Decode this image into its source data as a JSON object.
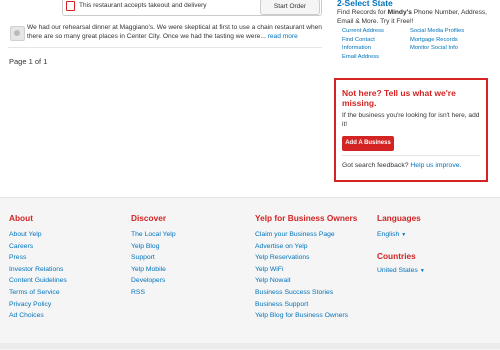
{
  "takeout": {
    "text": "This restaurant accepts takeout and delivery",
    "start_order": "Start Order"
  },
  "review": {
    "text": "We had our rehearsal dinner at Maggiano's. We were skeptical at first to use a chain restaurant when there are so many great places in Center City. Once we had the tasting we were...",
    "read_more": "read more"
  },
  "pagination": "Page 1 of 1",
  "select_state": {
    "title": "2-Select State",
    "desc_prefix": "Find Records for ",
    "desc_name": "Mindy's",
    "desc_suffix": " Phone Number, Address, Email & More. Try it Free!!",
    "links_left": [
      "Current Address",
      "Find Contact",
      "Information",
      "Email Address"
    ],
    "links_right": [
      "Social Media Profiles",
      "Mortgage Records",
      "Monitor Social Info"
    ]
  },
  "not_here": {
    "title": "Not here? Tell us what we're missing.",
    "text": "If the business you're looking for isn't here, add it!",
    "button": "Add A Business",
    "feedback_prefix": "Got search feedback?",
    "feedback_link": "Help us improve."
  },
  "footer": {
    "about": {
      "heading": "About",
      "links": [
        "About Yelp",
        "Careers",
        "Press",
        "Investor Relations",
        "Content Guidelines",
        "Terms of Service",
        "Privacy Policy",
        "Ad Choices"
      ]
    },
    "discover": {
      "heading": "Discover",
      "links": [
        "The Local Yelp",
        "Yelp Blog",
        "Support",
        "Yelp Mobile",
        "Developers",
        "RSS"
      ]
    },
    "owners": {
      "heading": "Yelp for Business Owners",
      "links": [
        "Claim your Business Page",
        "Advertise on Yelp",
        "Yelp Reservations",
        "Yelp WiFi",
        "Yelp Nowait",
        "Business Success Stories",
        "Business Support",
        "Yelp Blog for Business Owners"
      ]
    },
    "languages": {
      "heading": "Languages",
      "value": "English"
    },
    "countries": {
      "heading": "Countries",
      "value": "United States"
    }
  },
  "colors": {
    "brand_red": "#d32323",
    "link_blue": "#0073bb"
  }
}
